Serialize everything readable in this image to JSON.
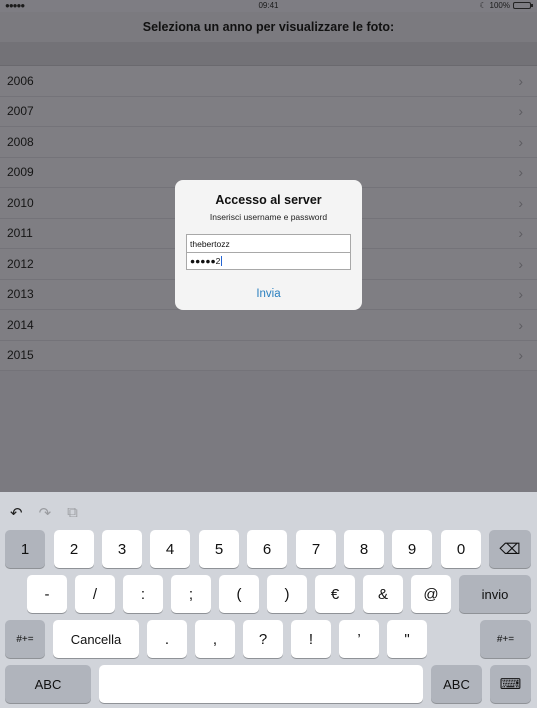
{
  "status_bar": {
    "signal": "●●●●● ",
    "time": "09:41",
    "battery_text": "100%"
  },
  "nav": {
    "title": "Seleziona un anno per visualizzare le foto:"
  },
  "years": [
    "2006",
    "2007",
    "2008",
    "2009",
    "2010",
    "2011",
    "2012",
    "2013",
    "2014",
    "2015"
  ],
  "chevron": "›",
  "alert": {
    "title": "Accesso al server",
    "message": "Inserisci username e password",
    "username": "thebertozz",
    "password": "●●●●●2",
    "action": "Invia"
  },
  "keyboard": {
    "undo": "↶",
    "redo": "↷",
    "paste": "⧉",
    "row1": [
      "1",
      "2",
      "3",
      "4",
      "5",
      "6",
      "7",
      "8",
      "9",
      "0"
    ],
    "delete": "⌫",
    "row2": [
      "-",
      "/",
      ":",
      ";",
      "(",
      ")",
      "€",
      "&",
      "@"
    ],
    "return": "invio",
    "sym_left": "#+=",
    "cancel": "Cancella",
    "row3": [
      ".",
      ",",
      "?",
      "!",
      "’",
      "\""
    ],
    "sym_right": "#+=",
    "abc_left": "ABC",
    "space": "",
    "abc_right": "ABC",
    "hide": "⌨"
  }
}
